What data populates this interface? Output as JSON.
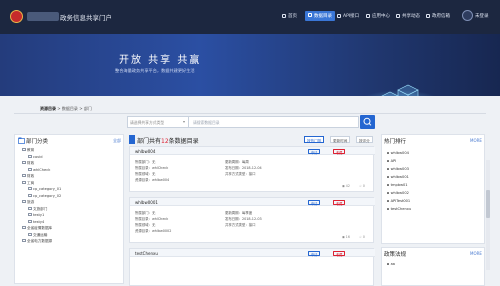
{
  "topnav": {
    "title": "政务信息共享门户",
    "items": [
      {
        "label": "首页",
        "icon": "home-icon"
      },
      {
        "label": "数据目录",
        "icon": "catalog-icon"
      },
      {
        "label": "API接口",
        "icon": "api-icon"
      },
      {
        "label": "应用中心",
        "icon": "app-icon"
      },
      {
        "label": "共享动态",
        "icon": "news-icon"
      },
      {
        "label": "政府信箱",
        "icon": "mail-icon"
      }
    ],
    "user": "未登录"
  },
  "banner": {
    "title": "开放  共享  共赢",
    "subtitle": "整合海量政务共享平台，数据共建更好生活"
  },
  "breadcrumb": {
    "items": [
      "资源目录",
      "数据目录",
      "部门"
    ]
  },
  "search": {
    "select_placeholder": "请选择共享方式类型",
    "input_placeholder": "请搜索数据目录"
  },
  "left_panel": {
    "title": "部门分类",
    "more": "全部",
    "tree": [
      "教育",
      "covid",
      "whlCheck",
      "财政",
      "工商",
      "cp_category_01",
      "cp_category_02",
      "旅游",
      "文旅部门",
      "testy1",
      "testy4",
      "全省疫情数据库",
      "交通运输",
      "全省电力数据源"
    ]
  },
  "middle": {
    "title_prefix": "部门共有",
    "count": "12",
    "title_suffix": "条数据目录",
    "sort_buttons": [
      "按热门排",
      "更新时间",
      "按评分"
    ],
    "cards": [
      {
        "title": "whlbw004",
        "btn_apply": "申请",
        "btn_fav": "收藏",
        "fields": [
          "所属部门：无",
          "所属目录：whlCheck",
          "所属领域：无",
          "资源目录：whlbw004"
        ],
        "fields_right": [
          "更新周期：每周",
          "发布日期：2018-12-04",
          "共享方式类型：接口"
        ],
        "views": "42",
        "stars": "0"
      },
      {
        "title": "whlbw0001",
        "btn_apply": "申请",
        "btn_fav": "收藏",
        "fields": [
          "所属部门：无",
          "所属目录：whlCheck",
          "所属领域：无",
          "资源目录：whlbw0002"
        ],
        "fields_right": [
          "更新周期：每季度",
          "发布日期：2018-12-03",
          "共享方式类型：接口"
        ],
        "views": "16",
        "stars": "0"
      },
      {
        "title": "testChenxu",
        "btn_apply": "申请",
        "btn_fav": "收藏",
        "fields": [],
        "fields_right": [],
        "views": "",
        "stars": ""
      }
    ]
  },
  "right_panel": {
    "rank_title": "热门排行",
    "rank_more": "MORE",
    "rank_items": [
      "whlbw004",
      "API",
      "whlbw003",
      "whlbw001",
      "tmpbw01",
      "whlbw002",
      "APITest001",
      "testChenxu"
    ],
    "process_title": "政策法规",
    "process_more": "MORE",
    "process_items": [
      "aa"
    ]
  },
  "colors": {
    "nav_bg": "#1c2740",
    "accent": "#2466d1",
    "highlight": "#dd2233"
  }
}
